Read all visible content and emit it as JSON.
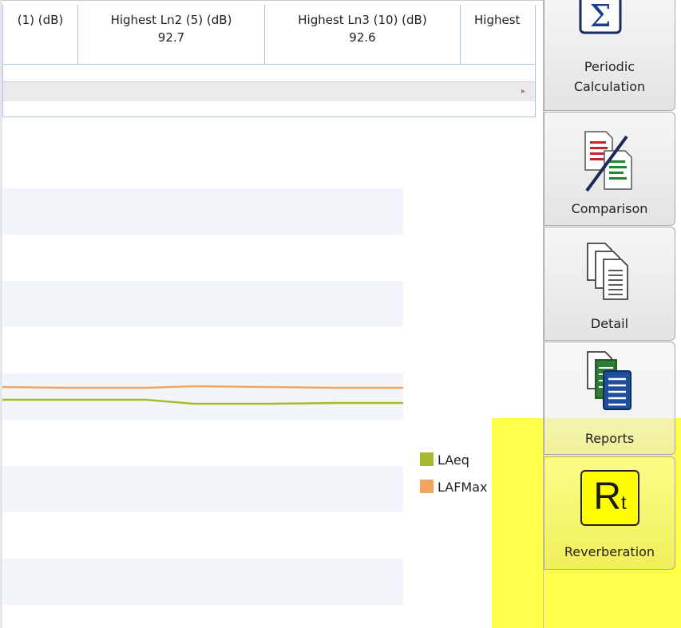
{
  "table": {
    "columns": [
      {
        "header": "(1) (dB)",
        "value": ""
      },
      {
        "header": "Highest Ln2 (5) (dB)",
        "value": "92.7"
      },
      {
        "header": "Highest Ln3 (10) (dB)",
        "value": "92.6"
      },
      {
        "header": "Highest",
        "value": ""
      }
    ]
  },
  "chart_data": {
    "type": "line",
    "series": [
      {
        "name": "LAeq",
        "color": "#a9b92f"
      },
      {
        "name": "LAFMax",
        "color": "#f2a55c"
      }
    ]
  },
  "legend": {
    "items": [
      {
        "label": "LAeq",
        "color": "#a9b92f"
      },
      {
        "label": "LAFMax",
        "color": "#f2a55c"
      }
    ]
  },
  "toolbar": {
    "periodic_label_line1": "Periodic",
    "periodic_label_line2": "Calculation",
    "comparison_label": "Comparison",
    "detail_label": "Detail",
    "reports_label": "Reports",
    "reverberation_label": "Reverberation",
    "reverberation_icon_main": "R",
    "reverberation_icon_sub": "t",
    "periodic_icon": "sigma-icon",
    "comparison_icon": "compare-documents-icon",
    "detail_icon": "documents-stack-icon",
    "reports_icon": "reports-icon",
    "highlight_color": "#ffff00"
  }
}
